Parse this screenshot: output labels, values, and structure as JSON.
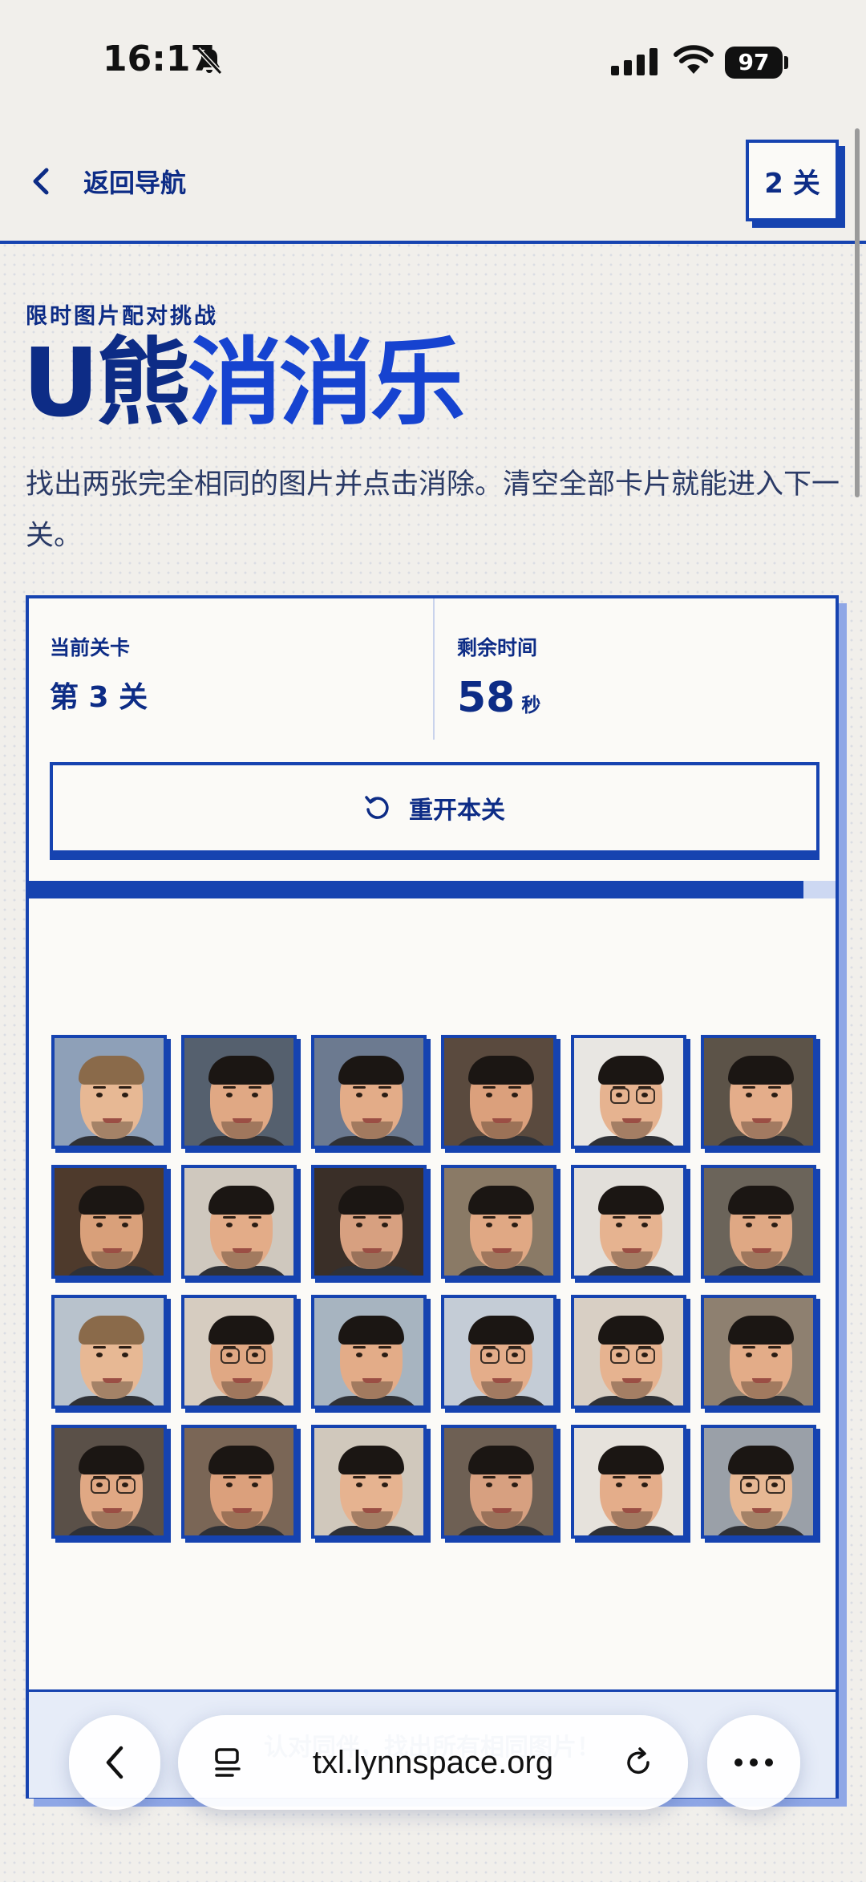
{
  "status_bar": {
    "time": "16:17",
    "battery": "97"
  },
  "nav": {
    "back_label": "返回导航",
    "badge": "2 关"
  },
  "hero": {
    "eyebrow": "限时图片配对挑战",
    "title_part1": "U熊",
    "title_part2": "消消乐",
    "subtitle": "找出两张完全相同的图片并点击消除。清空全部卡片就能进入下一关。"
  },
  "stats": {
    "level_label": "当前关卡",
    "level_value": "第 3 关",
    "time_label": "剩余时间",
    "time_value": "58",
    "time_unit": "秒"
  },
  "restart_label": "重开本关",
  "time_progress": 0.96,
  "footer_hint": "认对同伴，找出所有相同图片！",
  "browser": {
    "url": "txl.lynnspace.org"
  },
  "colors": {
    "brand_blue": "#1643b0",
    "navy": "#0d2c86",
    "page_bg": "#f1efeb"
  },
  "cards": [
    {
      "bg": "#8ea0b8",
      "skin": "#e7b894",
      "hair": "#8a6a4a",
      "glasses": false
    },
    {
      "bg": "#55606e",
      "skin": "#e0a884",
      "hair": "#1b1613",
      "glasses": false
    },
    {
      "bg": "#6c7a90",
      "skin": "#e3ac88",
      "hair": "#1b1613",
      "glasses": false
    },
    {
      "bg": "#5a4a3e",
      "skin": "#dba07c",
      "hair": "#1b1613",
      "glasses": false
    },
    {
      "bg": "#e8e6e2",
      "skin": "#e6b390",
      "hair": "#1b1613",
      "glasses": true
    },
    {
      "bg": "#5c5348",
      "skin": "#e4ad8a",
      "hair": "#1b1613",
      "glasses": false
    },
    {
      "bg": "#4e3a2c",
      "skin": "#d9a07a",
      "hair": "#1b1613",
      "glasses": false
    },
    {
      "bg": "#cfc8be",
      "skin": "#e3ac88",
      "hair": "#1b1613",
      "glasses": false
    },
    {
      "bg": "#3a2f28",
      "skin": "#d7a080",
      "hair": "#1b1613",
      "glasses": false
    },
    {
      "bg": "#8a7a66",
      "skin": "#e0a884",
      "hair": "#1b1613",
      "glasses": false
    },
    {
      "bg": "#e2dfda",
      "skin": "#e6b390",
      "hair": "#1b1613",
      "glasses": false
    },
    {
      "bg": "#6b645a",
      "skin": "#dfa884",
      "hair": "#1b1613",
      "glasses": false
    },
    {
      "bg": "#b8c2cc",
      "skin": "#e7b894",
      "hair": "#8a6a4a",
      "glasses": false
    },
    {
      "bg": "#d6ccc0",
      "skin": "#e0a884",
      "hair": "#1b1613",
      "glasses": true
    },
    {
      "bg": "#a7b4c0",
      "skin": "#e3ac88",
      "hair": "#1b1613",
      "glasses": false
    },
    {
      "bg": "#c4ccd6",
      "skin": "#e4ad8a",
      "hair": "#1b1613",
      "glasses": true
    },
    {
      "bg": "#d8cfc4",
      "skin": "#e6b390",
      "hair": "#1b1613",
      "glasses": true
    },
    {
      "bg": "#8e8070",
      "skin": "#e3ac88",
      "hair": "#1b1613",
      "glasses": false
    },
    {
      "bg": "#5a5048",
      "skin": "#e0a884",
      "hair": "#1b1613",
      "glasses": true
    },
    {
      "bg": "#7a6656",
      "skin": "#dba07c",
      "hair": "#1b1613",
      "glasses": false
    },
    {
      "bg": "#d0c8bc",
      "skin": "#e6b390",
      "hair": "#1b1613",
      "glasses": false
    },
    {
      "bg": "#6e6054",
      "skin": "#d7a080",
      "hair": "#1b1613",
      "glasses": false
    },
    {
      "bg": "#e6e2dc",
      "skin": "#e4ad8a",
      "hair": "#1b1613",
      "glasses": false
    },
    {
      "bg": "#9aa0a8",
      "skin": "#e7b894",
      "hair": "#1b1613",
      "glasses": true
    }
  ]
}
